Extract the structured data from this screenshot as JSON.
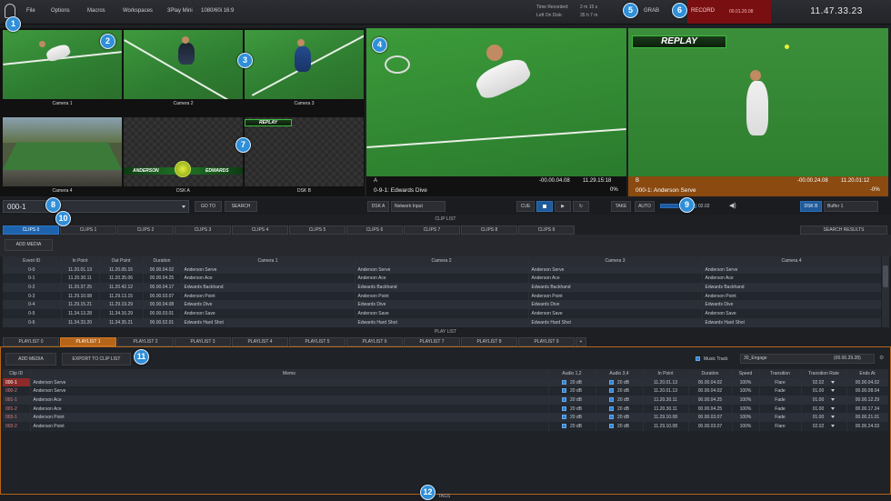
{
  "menu": {
    "items": [
      "File",
      "Options",
      "Macros",
      "Workspaces"
    ],
    "product": "3Play Mini",
    "format": "1080/60i 16:9"
  },
  "status": {
    "time_recorded_label": "Time Recorded:",
    "time_recorded_value": "2 m 15 s",
    "left_on_disk_label": "Left On Disk:",
    "left_on_disk_value": "35 h 7 m",
    "grab_label": "GRAB",
    "record_label": "RECORD",
    "record_timecode": "00.01.20.08",
    "clock": "11.47.33.23"
  },
  "badges": [
    "1",
    "2",
    "3",
    "4",
    "5",
    "6",
    "7",
    "8",
    "9",
    "10",
    "11",
    "12"
  ],
  "multiview": {
    "cameras": [
      "Camera 1",
      "Camera 2",
      "Camera 3",
      "Camera 4"
    ],
    "dsk_a": "DSK A",
    "dsk_b": "DSK B",
    "replay_text": "REPLAY",
    "anderson": "ANDERSON",
    "edwards": "EDWARDS"
  },
  "monitors": {
    "a": {
      "letter": "A",
      "clip": "0-9-1: Edwards Dive",
      "timecode_left": "-00.00.04.08",
      "timecode_right": "11.29.15:18",
      "percent": "0%"
    },
    "b": {
      "letter": "B",
      "clip": "000-1: Anderson Serve",
      "timecode_left": "-00.00.24.08",
      "timecode_right": "11.20.01:12",
      "percent": "-0%",
      "replay_text": "REPLAY"
    }
  },
  "controls": {
    "clip_field": "000-1",
    "goto": "GO TO",
    "search": "SEARCH",
    "dsk_a": "DSK A",
    "network_input": "Network Input",
    "cue": "CUE",
    "take": "TAKE",
    "auto": "AUTO",
    "speed_value": "02.02",
    "dsk_b": "DSK B",
    "buffer": "Buffer 1"
  },
  "clip_list": {
    "title": "CLIP LIST",
    "tabs": [
      "CLIPS 0",
      "CLIPS 1",
      "CLIPS 2",
      "CLIPS 3",
      "CLIPS 4",
      "CLIPS 5",
      "CLIPS 6",
      "CLIPS 7",
      "CLIPS 8",
      "CLIPS 9"
    ],
    "search_results": "SEARCH RESULTS",
    "add_media": "ADD MEDIA",
    "columns": [
      "Event ID",
      "In Point",
      "Out Point",
      "Duration",
      "Camera 1",
      "Camera 2",
      "Camera 3",
      "Camera 4"
    ],
    "rows": [
      [
        "0-0",
        "11.20.01.13",
        "11.20.05.15",
        "00.00.04.02",
        "Anderson Serve",
        "Anderson Serve",
        "Anderson Serve",
        "Anderson Serve"
      ],
      [
        "0-1",
        "11.20.30.11",
        "11.20.35.06",
        "00.00.04.25",
        "Anderson Ace",
        "Anderson Ace",
        "Anderson Ace",
        "Anderson Ace"
      ],
      [
        "0-2",
        "11.20.37.25",
        "11.20.42.12",
        "00.00.04.17",
        "Edwards Backhand",
        "Edwards Backhand",
        "Edwards Backhand",
        "Edwards Backhand"
      ],
      [
        "0-3",
        "11.29.10.08",
        "11.29.13.15",
        "00.00.03.07",
        "Anderson Point",
        "Anderson Point",
        "Anderson Point",
        "Anderson Point"
      ],
      [
        "0-4",
        "11.29.15.21",
        "11.29.19.29",
        "00.00.04.08",
        "Edwards Dive",
        "Edwards Dive",
        "Edwards Dive",
        "Edwards Dive"
      ],
      [
        "0-5",
        "11.34.13.28",
        "11.34.16.29",
        "00.00.03.01",
        "Anderson Save",
        "Anderson Save",
        "Anderson Save",
        "Anderson Save"
      ],
      [
        "0-6",
        "11.34.33.20",
        "11.34.35.21",
        "00.00.02.01",
        "Edwards Hard Shot",
        "Edwards Hard Shot",
        "Edwards Hard Shot",
        "Edwards Hard Shot"
      ]
    ]
  },
  "play_list": {
    "title": "PLAY LIST",
    "tabs": [
      "PLAYLIST 0",
      "PLAYLIST 1",
      "PLAYLIST 2",
      "PLAYLIST 3",
      "PLAYLIST 4",
      "PLAYLIST 5",
      "PLAYLIST 6",
      "PLAYLIST 7",
      "PLAYLIST 8",
      "PLAYLIST 9"
    ],
    "add_tab": "+",
    "add_media": "ADD MEDIA",
    "export": "EXPORT TO CLIP LIST",
    "music_track_label": "Music Track",
    "music_track_value": "30_Engage",
    "music_duration": "(00.00.29.28)",
    "columns": [
      "Clip ID",
      "Memo",
      "Audio 1,2",
      "Audio 3,4",
      "In Point",
      "Duration",
      "Speed",
      "Transition",
      "Transition Rate",
      "Ends At"
    ],
    "rows": [
      [
        "000-1",
        "Anderson Serve",
        "20 dB",
        "20 dB",
        "11.20.01.13",
        "00.00.04.02",
        "100%",
        "Flare",
        "02.02",
        "00.00.04.02"
      ],
      [
        "000-2",
        "Anderson Serve",
        "20 dB",
        "20 dB",
        "11.20.01.13",
        "00.00.04.02",
        "100%",
        "Fade",
        "01.00",
        "00.00.08.04"
      ],
      [
        "001-1",
        "Anderson Ace",
        "20 dB",
        "20 dB",
        "11.20.30.11",
        "00.00.04.25",
        "100%",
        "Fade",
        "01.00",
        "00.00.12.29"
      ],
      [
        "001-2",
        "Anderson Ace",
        "20 dB",
        "20 dB",
        "11.20.30.11",
        "00.00.04.25",
        "100%",
        "Fade",
        "01.00",
        "00.00.17.24"
      ],
      [
        "003-1",
        "Anderson Point",
        "20 dB",
        "20 dB",
        "11.29.10.08",
        "00.00.03.07",
        "100%",
        "Fade",
        "01.00",
        "00.00.21.01"
      ],
      [
        "003-2",
        "Anderson Point",
        "20 dB",
        "20 dB",
        "11.29.10.08",
        "00.00.03.07",
        "100%",
        "Flare",
        "02.02",
        "00.00.24.03"
      ]
    ]
  },
  "tags_label": "TAGS",
  "colors": {
    "accent_blue": "#1e63ad",
    "record_red": "#7a0f12",
    "playlist_orange": "#b5651a",
    "badge": "#2f8fd8"
  }
}
